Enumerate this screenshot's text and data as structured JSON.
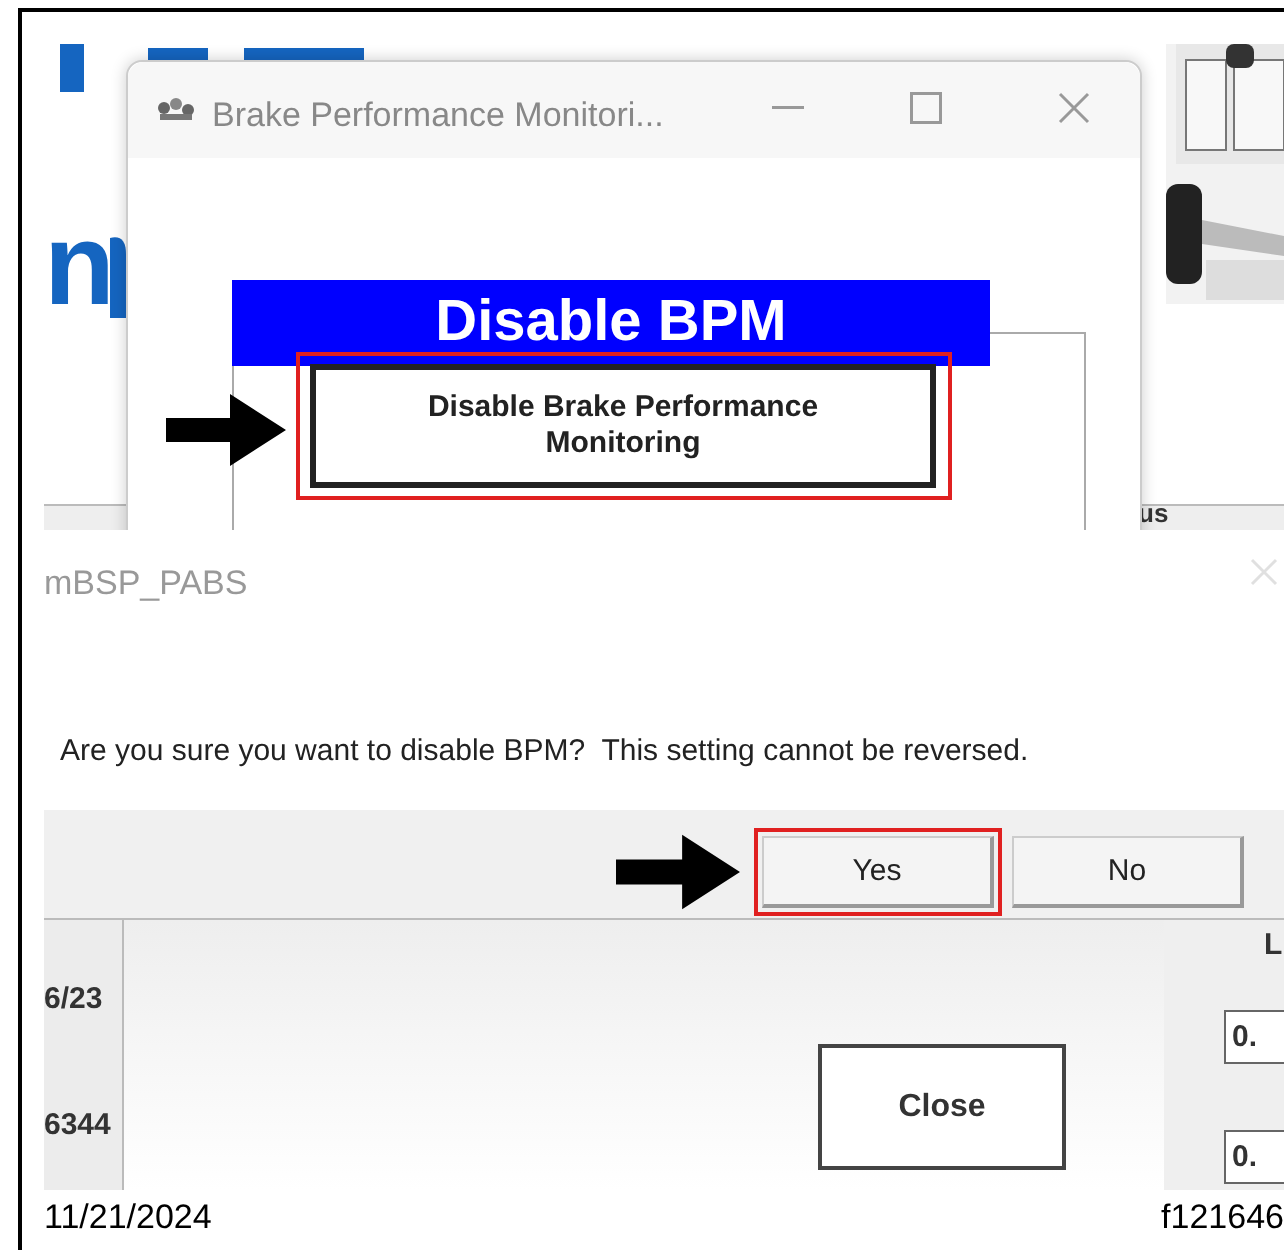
{
  "background_app": {
    "logo_fragment": "n",
    "column_label": "us",
    "left_cells": [
      "6/23",
      "6344"
    ],
    "right_label": "L",
    "right_fields": [
      "0.",
      "0."
    ],
    "close_button": "Close"
  },
  "bpm_window": {
    "title": "Brake Performance Monitori...",
    "banner": "Disable BPM",
    "action_button": {
      "label": "Disable Brake Performance Monitoring",
      "highlighted": true
    }
  },
  "dialog": {
    "title": "mBSP_PABS",
    "message": "Are you sure you want to disable BPM?  This setting cannot be reversed.",
    "buttons": [
      {
        "label": "Yes",
        "highlighted": true
      },
      {
        "label": "No",
        "highlighted": false
      }
    ]
  },
  "caption": {
    "date": "11/21/2024",
    "figure_id": "f121646"
  }
}
